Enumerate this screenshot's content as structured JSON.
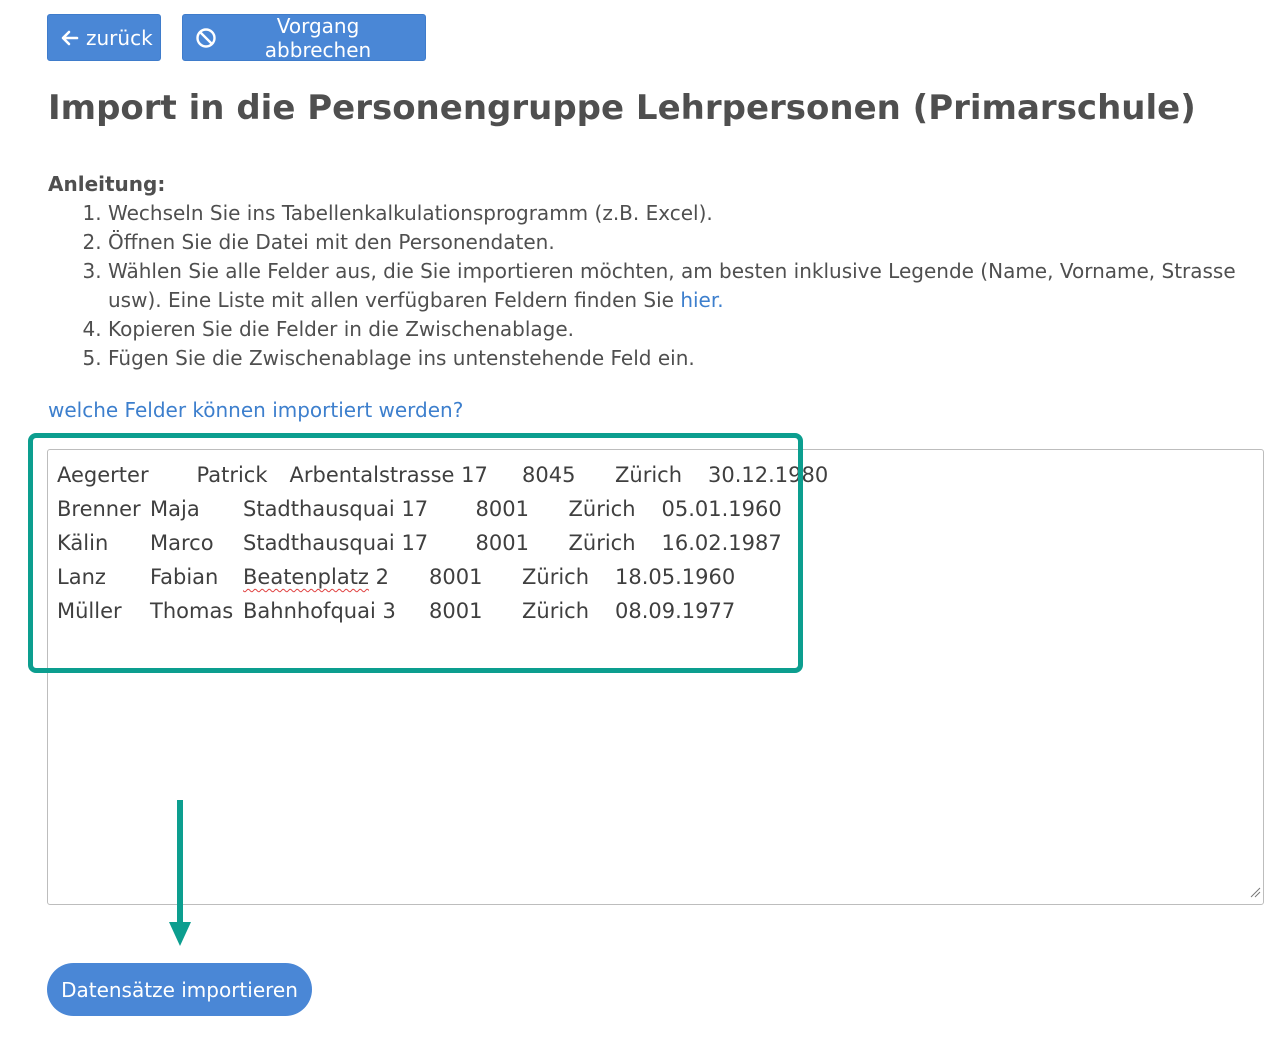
{
  "toolbar": {
    "back_label": "zurück",
    "cancel_label": "Vorgang abbrechen"
  },
  "page_title": "Import in die Personengruppe Lehrpersonen (Primarschule)",
  "instructions": {
    "title": "Anleitung:",
    "steps": [
      "Wechseln Sie ins Tabellenkalkulationsprogramm (z.B. Excel).",
      "Öffnen Sie die Datei mit den Personendaten.",
      "Wählen Sie alle Felder aus, die Sie importieren möchten, am besten inklusive Legende (Name, Vorname, Strasse usw). Eine Liste mit allen verfügbaren Feldern finden Sie ",
      "Kopieren Sie die Felder in die Zwischenablage.",
      "Fügen Sie die Zwischenablage ins untenstehende Feld ein."
    ],
    "step3_link": "hier."
  },
  "fields_link": "welche Felder können importiert werden?",
  "paste_rows": [
    [
      "Aegerter",
      "Patrick",
      "Arbentalstrasse 17",
      "8045",
      "Zürich",
      "30.12.1980"
    ],
    [
      "Brenner",
      "Maja",
      "Stadthausquai 17",
      "8001",
      "Zürich",
      "05.01.1960"
    ],
    [
      "Kälin",
      "Marco",
      "Stadthausquai 17",
      "8001",
      "Zürich",
      "16.02.1987"
    ],
    [
      "Lanz",
      "Fabian",
      "Beatenplatz 2",
      "8001",
      "Zürich",
      "18.05.1960"
    ],
    [
      "Müller",
      "Thomas",
      "Bahnhofquai 3",
      "8001",
      "Zürich",
      "08.09.1977"
    ]
  ],
  "import_button": "Datensätze importieren",
  "colors": {
    "primary": "#4a87d6",
    "link": "#3d7fcd",
    "annotation": "#0c9e8f",
    "spellcheck": "#e0403f"
  },
  "icons": {
    "back": "arrow-left-icon",
    "cancel": "ban-icon",
    "annotation_arrow": "arrow-down-icon"
  }
}
